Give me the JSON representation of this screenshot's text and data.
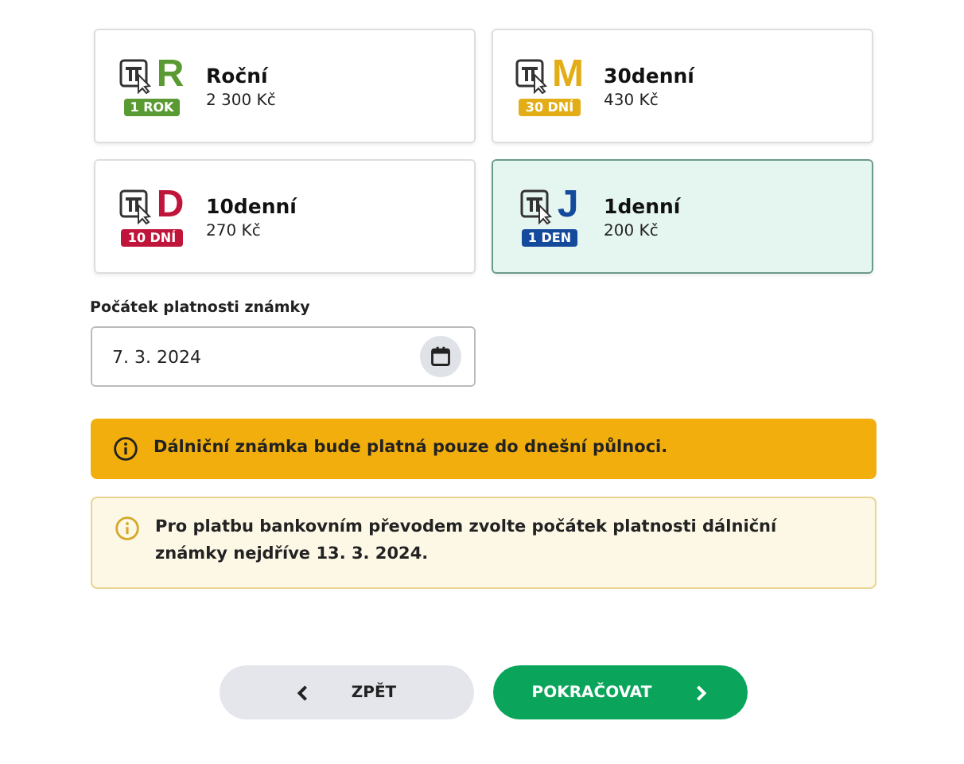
{
  "vignettes": [
    {
      "letter": "R",
      "badge": "1 ROK",
      "color": "#5a9a32",
      "title": "Roční",
      "price": "2 300 Kč",
      "selected": false
    },
    {
      "letter": "M",
      "badge": "30 DNÍ",
      "color": "#e2ad16",
      "title": "30denní",
      "price": "430 Kč",
      "selected": false
    },
    {
      "letter": "D",
      "badge": "10 DNÍ",
      "color": "#c0153a",
      "title": "10denní",
      "price": "270 Kč",
      "selected": false
    },
    {
      "letter": "J",
      "badge": "1 DEN",
      "color": "#144a9c",
      "title": "1denní",
      "price": "200 Kč",
      "selected": true
    }
  ],
  "start_date": {
    "label": "Počátek platnosti známky",
    "value": "7. 3. 2024"
  },
  "alerts": [
    {
      "kind": "warning",
      "text": "Dálniční známka bude platná pouze do dnešní půlnoci."
    },
    {
      "kind": "info",
      "text": "Pro platbu bankovním převodem zvolte počátek platnosti dálniční známky nejdříve 13. 3. 2024."
    }
  ],
  "buttons": [
    {
      "kind": "back",
      "label": "ZPĚT"
    },
    {
      "kind": "next",
      "label": "POKRAČOVAT"
    }
  ]
}
